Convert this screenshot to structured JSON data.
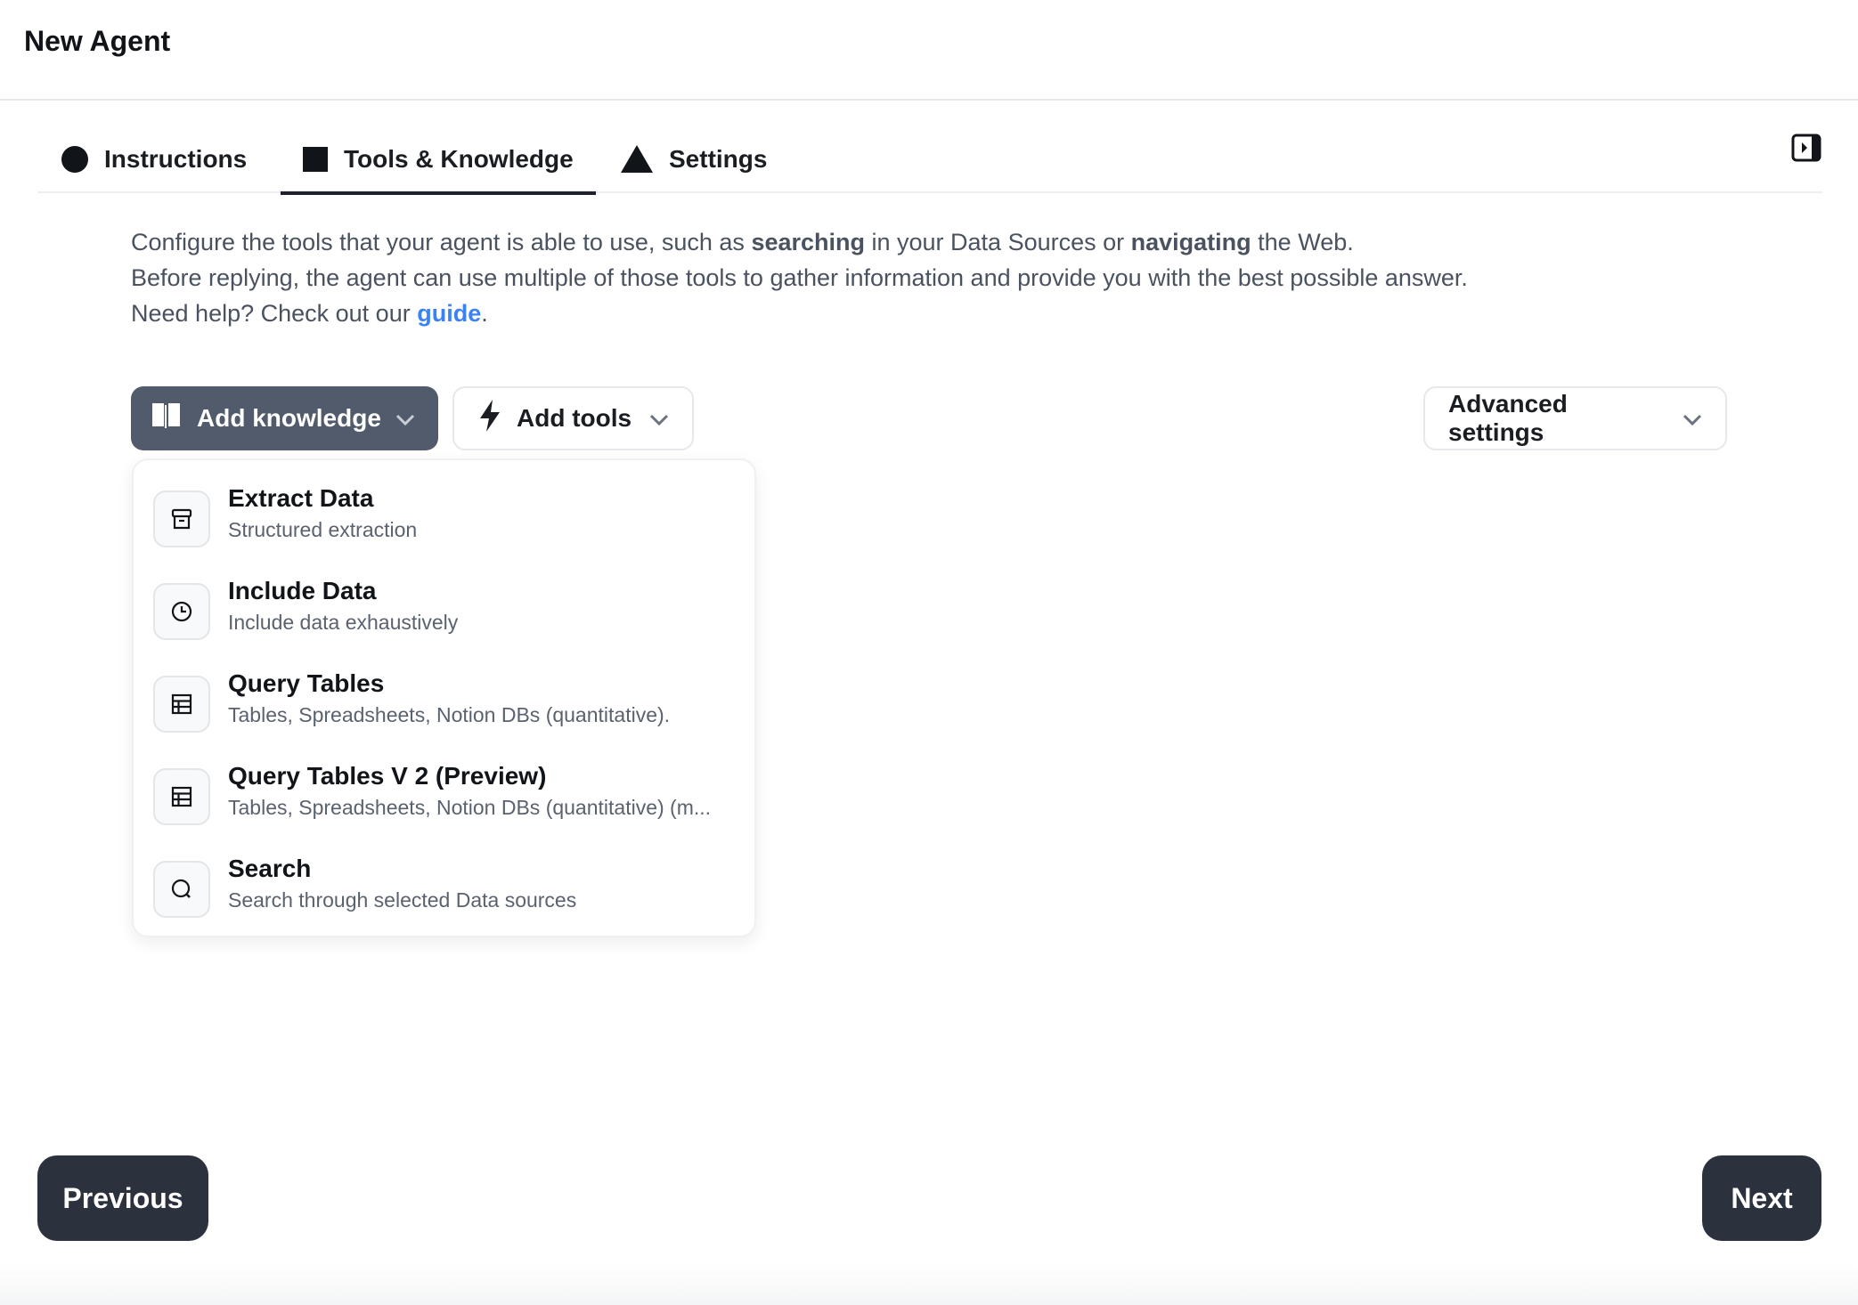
{
  "header": {
    "title": "New Agent"
  },
  "tabs": [
    {
      "label": "Instructions",
      "icon": "circle-icon"
    },
    {
      "label": "Tools & Knowledge",
      "icon": "square-icon",
      "active": true
    },
    {
      "label": "Settings",
      "icon": "triangle-icon"
    }
  ],
  "description": {
    "line1_pre": "Configure the tools that your agent is able to use, such as ",
    "line1_bold1": "searching",
    "line1_mid": " in your Data Sources or ",
    "line1_bold2": "navigating",
    "line1_post": " the Web.",
    "line2": "Before replying, the agent can use multiple of those tools to gather information and provide you with the best possible answer.",
    "line3_pre": "Need help? Check out our ",
    "line3_link": "guide",
    "line3_post": "."
  },
  "actions": {
    "add_knowledge": "Add knowledge",
    "add_tools": "Add tools",
    "advanced_settings": "Advanced settings"
  },
  "dropdown": {
    "items": [
      {
        "name": "Extract Data",
        "sub": "Structured extraction",
        "icon": "archive-icon"
      },
      {
        "name": "Include Data",
        "sub": "Include data exhaustively",
        "icon": "clock-icon"
      },
      {
        "name": "Query Tables",
        "sub": "Tables, Spreadsheets, Notion DBs (quantitative).",
        "icon": "table-icon"
      },
      {
        "name": "Query Tables V 2 (Preview)",
        "sub": "Tables, Spreadsheets, Notion DBs (quantitative) (m...",
        "icon": "table-icon"
      },
      {
        "name": "Search",
        "sub": "Search through selected Data sources",
        "icon": "search-icon"
      }
    ]
  },
  "footer": {
    "previous": "Previous",
    "next": "Next"
  },
  "colors": {
    "primary_dark": "#2b313d",
    "knowledge_button": "#525b6b",
    "link": "#3b82f6"
  }
}
